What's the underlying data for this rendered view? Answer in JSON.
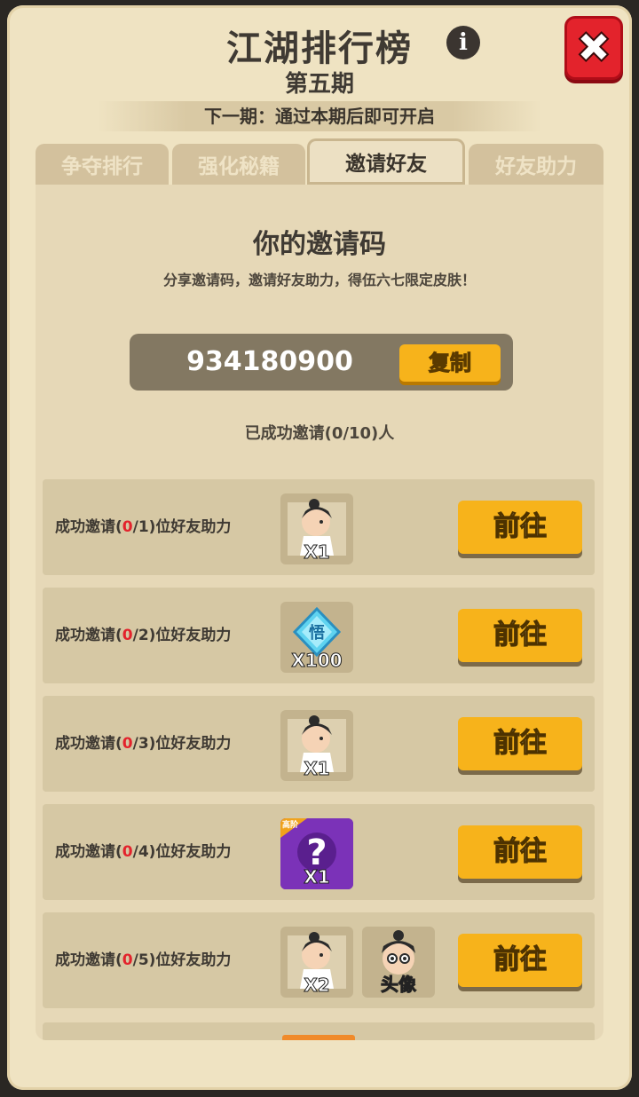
{
  "header": {
    "title": "江湖排行榜",
    "subtitle": "第五期",
    "next_period": "下一期：通过本期后即可开启",
    "info_icon": "info-icon",
    "close_icon": "close-icon"
  },
  "tabs": [
    {
      "label": "争夺排行",
      "active": false
    },
    {
      "label": "强化秘籍",
      "active": false
    },
    {
      "label": "邀请好友",
      "active": true
    },
    {
      "label": "好友助力",
      "active": false
    }
  ],
  "invite": {
    "title": "你的邀请码",
    "description": "分享邀请码，邀请好友助力，得伍六七限定皮肤！",
    "code": "934180900",
    "copy_label": "复制",
    "count_text": "已成功邀请(0/10)人"
  },
  "rows": [
    {
      "prefix": "成功邀请(",
      "done": "0",
      "total_text": "/1)位好友助力",
      "rewards": [
        {
          "icon": "character-shard-icon",
          "qty": "X1"
        }
      ],
      "button": "前往"
    },
    {
      "prefix": "成功邀请(",
      "done": "0",
      "total_text": "/2)位好友助力",
      "rewards": [
        {
          "icon": "enlightenment-gem-icon",
          "qty": "X100"
        }
      ],
      "button": "前往"
    },
    {
      "prefix": "成功邀请(",
      "done": "0",
      "total_text": "/3)位好友助力",
      "rewards": [
        {
          "icon": "character-shard-icon",
          "qty": "X1"
        }
      ],
      "button": "前往"
    },
    {
      "prefix": "成功邀请(",
      "done": "0",
      "total_text": "/4)位好友助力",
      "rewards": [
        {
          "icon": "mystery-box-icon",
          "qty": "X1",
          "badge": "高阶"
        }
      ],
      "button": "前往"
    },
    {
      "prefix": "成功邀请(",
      "done": "0",
      "total_text": "/5)位好友助力",
      "rewards": [
        {
          "icon": "character-shard-icon",
          "qty": "X2"
        },
        {
          "icon": "avatar-icon",
          "qty": "头像"
        }
      ],
      "button": "前往"
    }
  ],
  "colors": {
    "accent": "#f7b31b",
    "close_red": "#e3232c",
    "progress_red": "#e3232c"
  }
}
